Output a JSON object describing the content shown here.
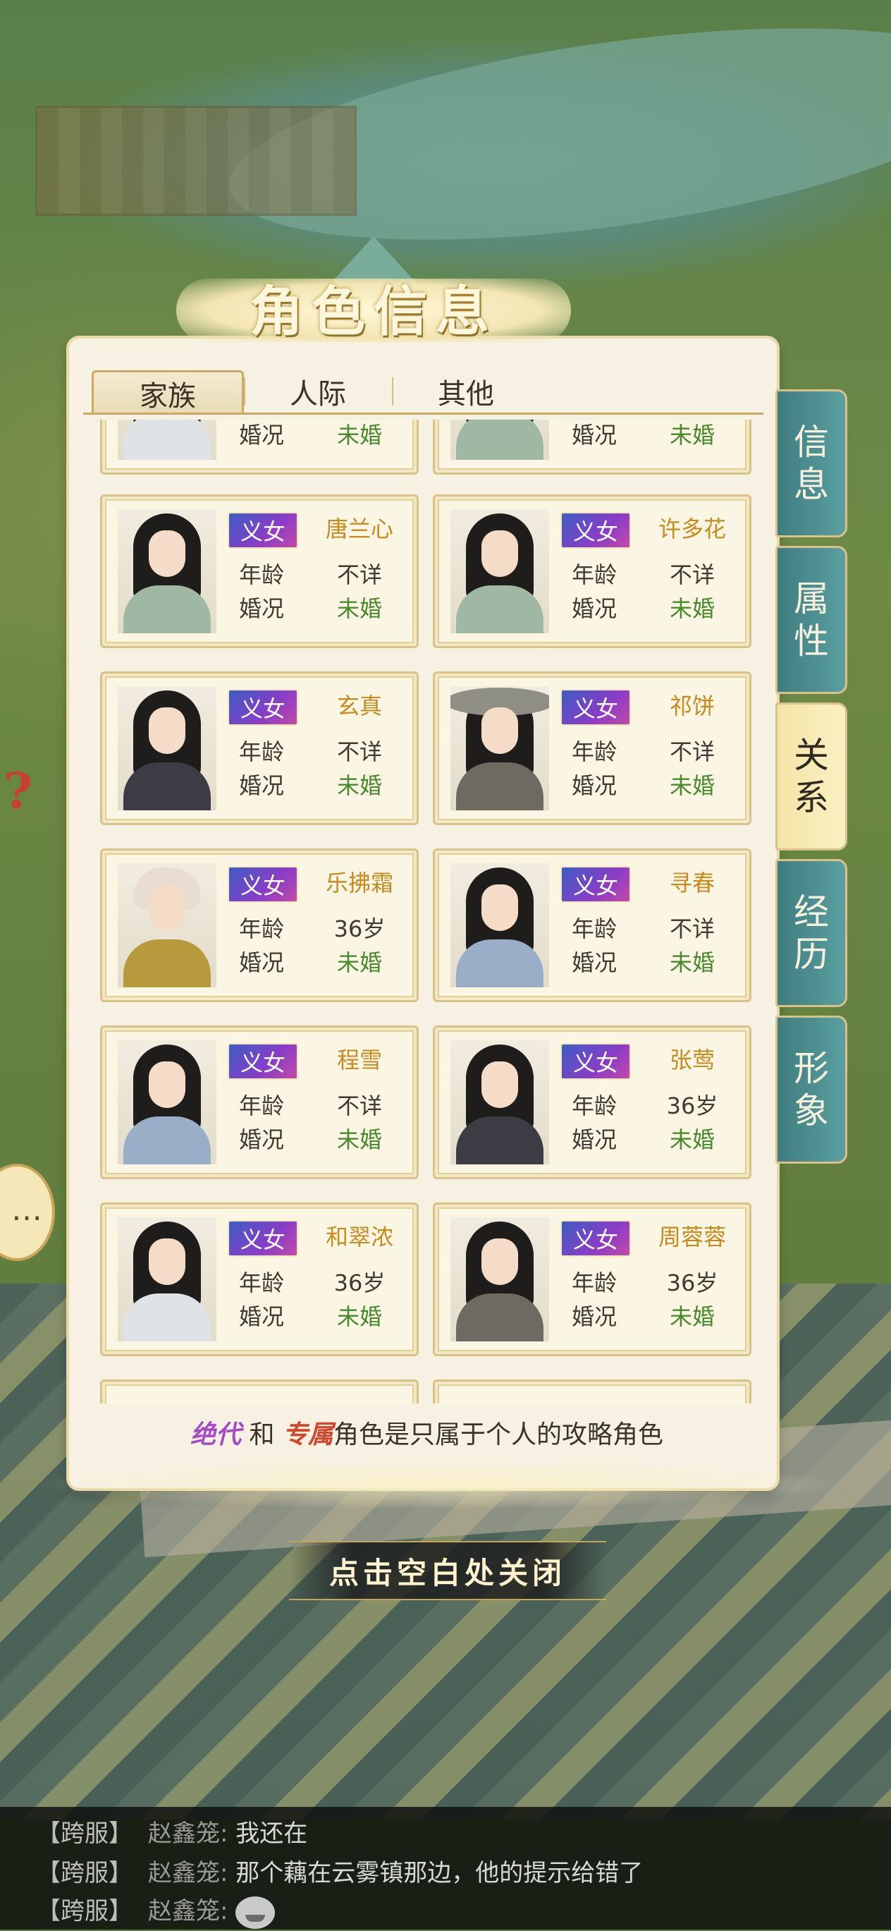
{
  "dialog": {
    "title": "角色信息",
    "close_hint": "点击空白处关闭"
  },
  "tabs": [
    {
      "label": "家族",
      "active": true
    },
    {
      "label": "人际",
      "active": false
    },
    {
      "label": "其他",
      "active": false
    }
  ],
  "side_tabs": [
    {
      "label": "信息",
      "active": false
    },
    {
      "label": "属性",
      "active": false
    },
    {
      "label": "关系",
      "active": true
    },
    {
      "label": "经历",
      "active": false
    },
    {
      "label": "形象",
      "active": false
    }
  ],
  "labels": {
    "age": "年龄",
    "marital": "婚况"
  },
  "top_partial": [
    {
      "marital": "未婚"
    },
    {
      "marital": "未婚"
    }
  ],
  "characters": [
    {
      "tag": "义女",
      "name": "唐兰心",
      "age": "不详",
      "marital": "未婚"
    },
    {
      "tag": "义女",
      "name": "许多花",
      "age": "不详",
      "marital": "未婚"
    },
    {
      "tag": "义女",
      "name": "玄真",
      "age": "不详",
      "marital": "未婚"
    },
    {
      "tag": "义女",
      "name": "祁饼",
      "age": "不详",
      "marital": "未婚"
    },
    {
      "tag": "义女",
      "name": "乐拂霜",
      "age": "36岁",
      "marital": "未婚"
    },
    {
      "tag": "义女",
      "name": "寻春",
      "age": "不详",
      "marital": "未婚"
    },
    {
      "tag": "义女",
      "name": "程雪",
      "age": "不详",
      "marital": "未婚"
    },
    {
      "tag": "义女",
      "name": "张莺",
      "age": "36岁",
      "marital": "未婚"
    },
    {
      "tag": "义女",
      "name": "和翠浓",
      "age": "36岁",
      "marital": "未婚"
    },
    {
      "tag": "义女",
      "name": "周蓉蓉",
      "age": "36岁",
      "marital": "未婚"
    }
  ],
  "footnote": {
    "kw1": "绝代",
    "mid": " 和 ",
    "kw2": "专属",
    "rest": "角色是只属于个人的攻略角色"
  },
  "chat": [
    {
      "channel": "【跨服】",
      "sender": "赵鑫笼:",
      "message": "我还在"
    },
    {
      "channel": "【跨服】",
      "sender": "赵鑫笼:",
      "message": "那个藕在云雾镇那边，他的提示给错了"
    },
    {
      "channel": "【跨服】",
      "sender": "赵鑫笼:",
      "message": "",
      "emoji": "laughing-emoji"
    }
  ],
  "icons": {
    "help": "?",
    "chat": "chat-bubble-icon"
  },
  "colors": {
    "panel": "#f6f1e2",
    "side_tab": "#4a8c8f",
    "badge": "#6a3fc6",
    "name": "#c98a1e",
    "unmarried": "#4a8a2e"
  }
}
